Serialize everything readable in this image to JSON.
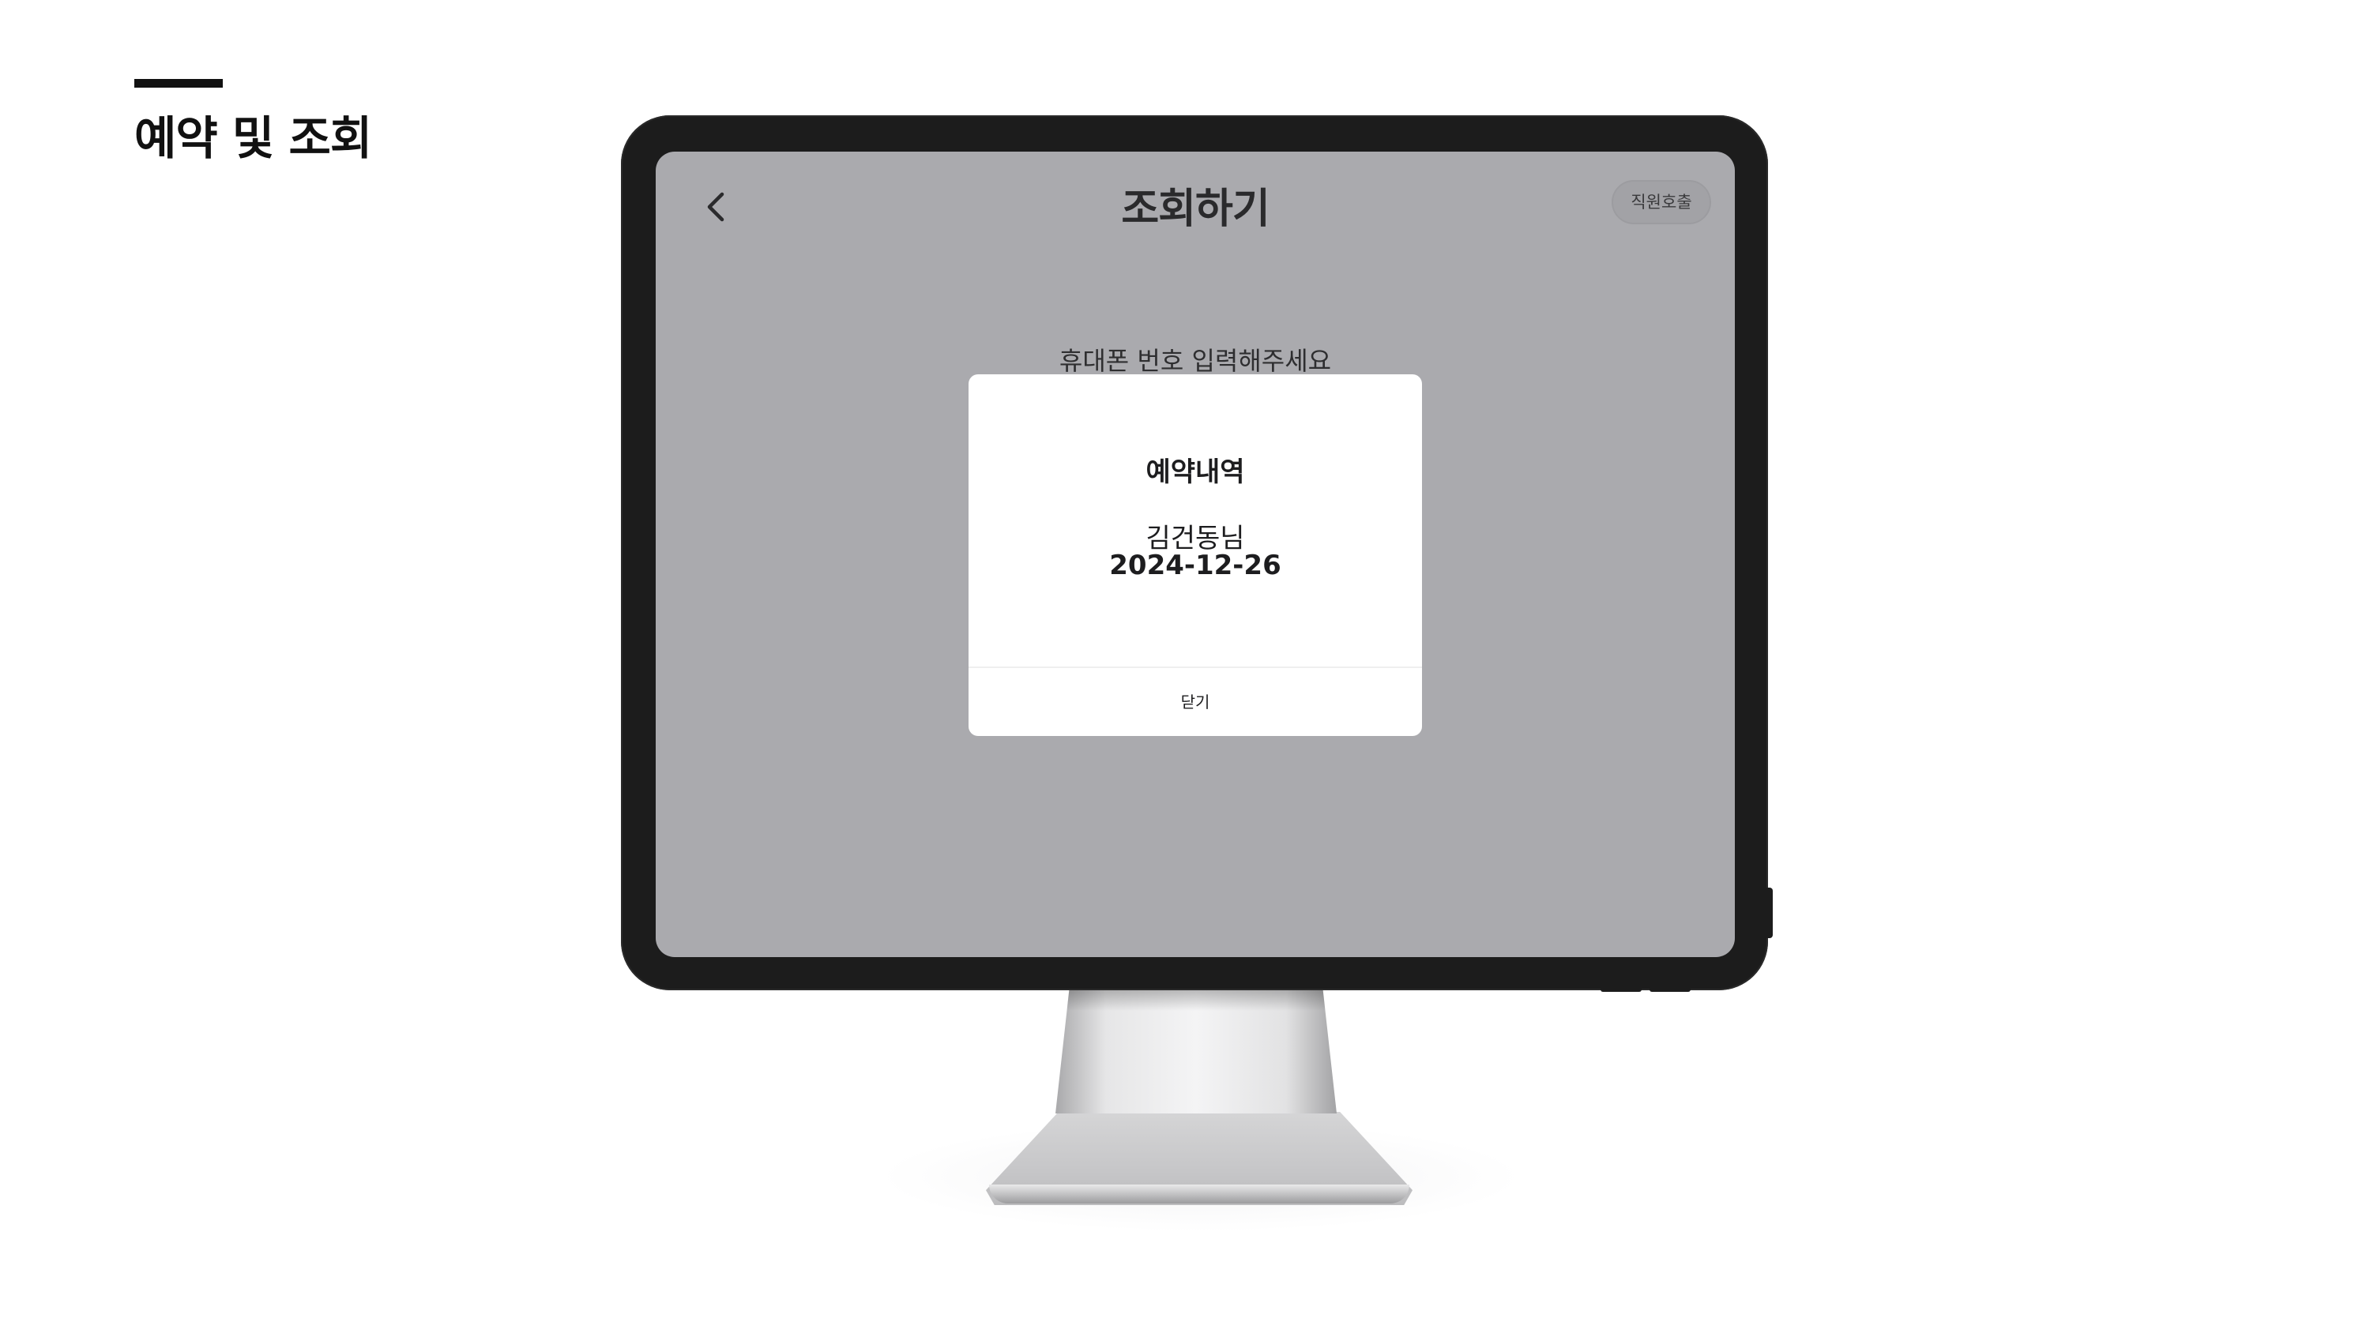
{
  "section": {
    "title": "예약 및 조회"
  },
  "screen": {
    "title": "조회하기",
    "staff_call_label": "직원호출",
    "phone_prompt": "휴대폰 번호 입력해주세요",
    "back_icon": "chevron-left-icon",
    "background_color": "#aaaaae"
  },
  "dialog": {
    "title": "예약내역",
    "customer_name": "김건동님",
    "reservation_date": "2024-12-26",
    "close_label": "닫기"
  }
}
